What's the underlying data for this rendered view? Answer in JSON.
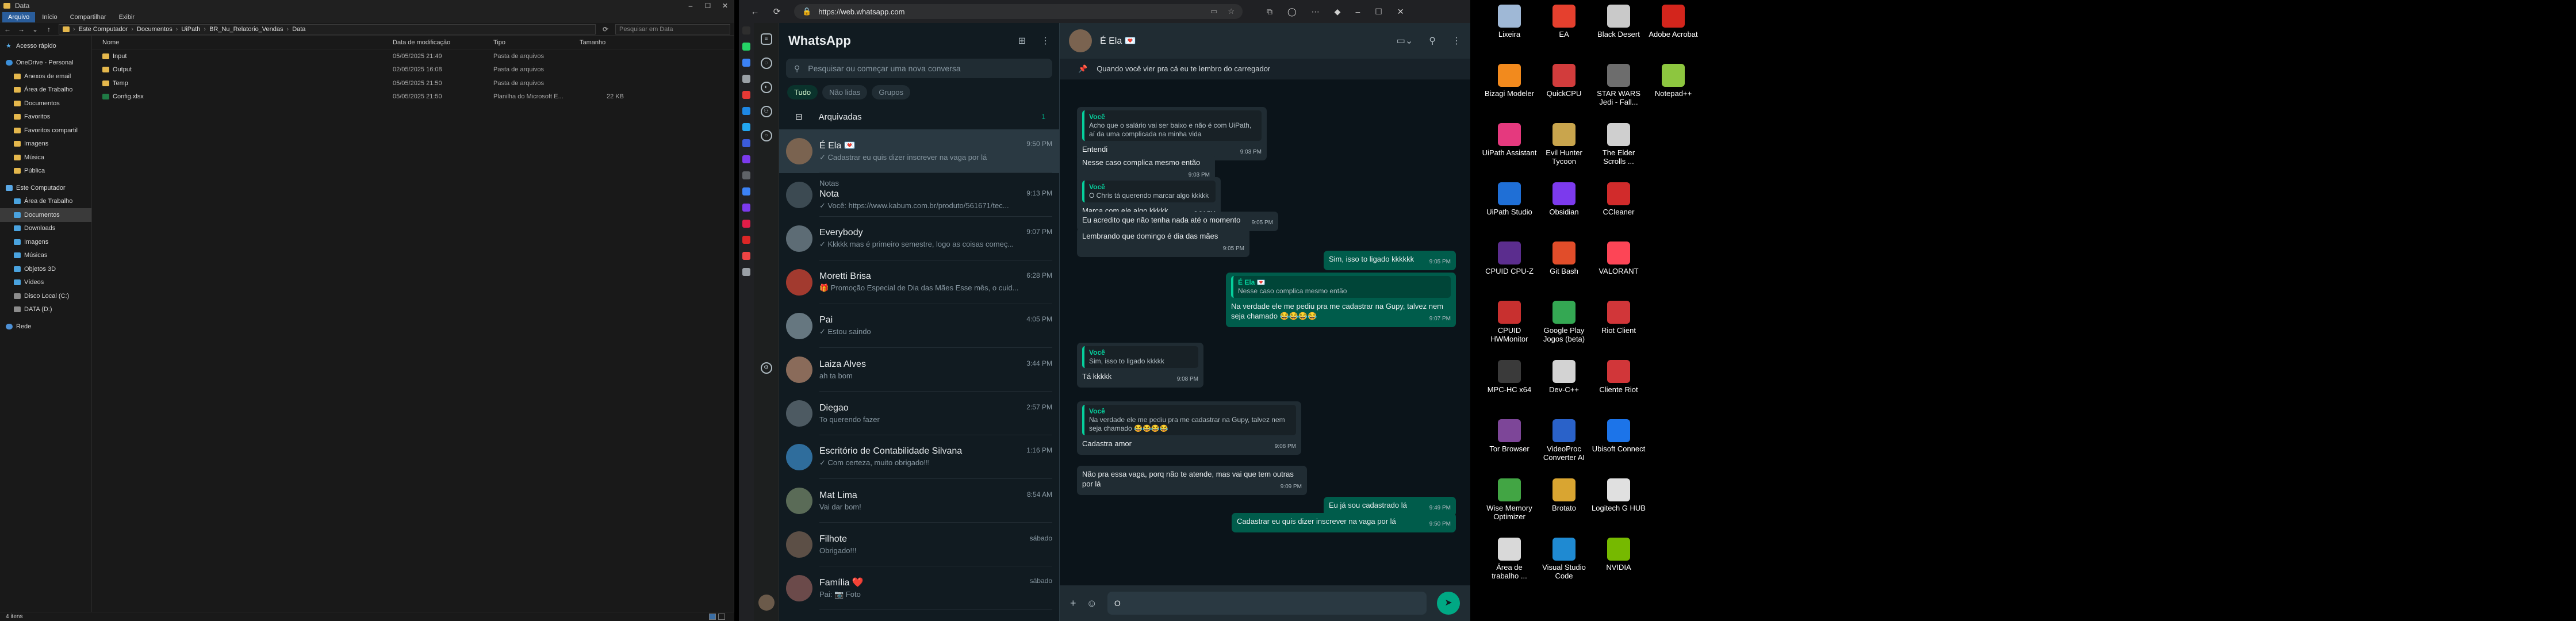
{
  "explorer": {
    "window_title": "Data",
    "ribbon_tabs": [
      "Arquivo",
      "Início",
      "Compartilhar",
      "Exibir"
    ],
    "breadcrumb": [
      "Este Computador",
      "Documentos",
      "UiPath",
      "BR_Nu_Relatorio_Vendas",
      "Data"
    ],
    "search_placeholder": "Pesquisar em Data",
    "nav": [
      {
        "label": "Acesso rápido",
        "icon": "star-icon",
        "level": 0
      },
      {
        "label": "OneDrive - Personal",
        "icon": "cloud-icon",
        "level": 0
      },
      {
        "label": "Anexos de email",
        "icon": "folder-icon",
        "level": 1
      },
      {
        "label": "Área de Trabalho",
        "icon": "folder-icon",
        "level": 1
      },
      {
        "label": "Documentos",
        "icon": "folder-icon",
        "level": 1
      },
      {
        "label": "Favoritos",
        "icon": "folder-icon",
        "level": 1
      },
      {
        "label": "Favoritos compartil",
        "icon": "folder-icon",
        "level": 1
      },
      {
        "label": "Imagens",
        "icon": "folder-icon",
        "level": 1
      },
      {
        "label": "Música",
        "icon": "folder-icon",
        "level": 1
      },
      {
        "label": "Pública",
        "icon": "folder-icon",
        "level": 1
      },
      {
        "label": "Este Computador",
        "icon": "computer-icon",
        "level": 0
      },
      {
        "label": "Área de Trabalho",
        "icon": "desktop-icon",
        "level": 1
      },
      {
        "label": "Documentos",
        "icon": "documents-icon",
        "level": 1,
        "selected": true
      },
      {
        "label": "Downloads",
        "icon": "downloads-icon",
        "level": 1
      },
      {
        "label": "Imagens",
        "icon": "pictures-icon",
        "level": 1
      },
      {
        "label": "Músicas",
        "icon": "music-icon",
        "level": 1
      },
      {
        "label": "Objetos 3D",
        "icon": "objects3d-icon",
        "level": 1
      },
      {
        "label": "Vídeos",
        "icon": "videos-icon",
        "level": 1
      },
      {
        "label": "Disco Local (C:)",
        "icon": "drive-icon",
        "level": 1
      },
      {
        "label": "DATA (D:)",
        "icon": "drive-icon",
        "level": 1
      },
      {
        "label": "Rede",
        "icon": "network-icon",
        "level": 0
      }
    ],
    "columns": [
      "Nome",
      "Data de modificação",
      "Tipo",
      "Tamanho"
    ],
    "files": [
      {
        "name": "Input",
        "modified": "05/05/2025 21:49",
        "type": "Pasta de arquivos",
        "size": "",
        "icon": "folder-icon"
      },
      {
        "name": "Output",
        "modified": "02/05/2025 16:08",
        "type": "Pasta de arquivos",
        "size": "",
        "icon": "folder-icon"
      },
      {
        "name": "Temp",
        "modified": "05/05/2025 21:50",
        "type": "Pasta de arquivos",
        "size": "",
        "icon": "folder-icon"
      },
      {
        "name": "Config.xlsx",
        "modified": "05/05/2025 21:50",
        "type": "Planilha do Microsoft E...",
        "size": "22 KB",
        "icon": "excel-icon"
      }
    ],
    "status": "4 itens"
  },
  "browser": {
    "url": "https://web.whatsapp.com"
  },
  "whatsapp": {
    "title": "WhatsApp",
    "search_placeholder": "Pesquisar ou começar uma nova conversa",
    "filters": [
      "Tudo",
      "Não lidas",
      "Grupos"
    ],
    "active_filter": "Tudo",
    "archived_label": "Arquivadas",
    "archived_count": "1",
    "chats": [
      {
        "name": "É Ela 💌",
        "time": "9:50 PM",
        "preview": "✓ Cadastrar eu quis dizer inscrever na vaga por lá",
        "selected": true
      },
      {
        "name": "Nota",
        "time": "9:13 PM",
        "preview": "✓ Você: https://www.kabum.com.br/produto/561671/tec...",
        "sub": "Notas"
      },
      {
        "name": "Everybody",
        "time": "9:07 PM",
        "preview": "✓ Kkkkk mas é primeiro semestre, logo as coisas começ..."
      },
      {
        "name": "Moretti Brisa",
        "time": "6:28 PM",
        "preview": "🎁 Promoção Especial de Dia das Mães Esse mês, o cuid..."
      },
      {
        "name": "Pai",
        "time": "4:05 PM",
        "preview": "✓ Estou saindo"
      },
      {
        "name": "Laiza Alves",
        "time": "3:44 PM",
        "preview": "ah ta bom"
      },
      {
        "name": "Diegao",
        "time": "2:57 PM",
        "preview": "To querendo fazer"
      },
      {
        "name": "Escritório de Contabilidade Silvana",
        "time": "1:16 PM",
        "preview": "✓ Com certeza, muito obrigado!!!"
      },
      {
        "name": "Mat Lima",
        "time": "8:54 AM",
        "preview": "Vai dar bom!"
      },
      {
        "name": "Filhote",
        "time": "sábado",
        "preview": "Obrigado!!!"
      },
      {
        "name": "Família ❤️",
        "time": "sábado",
        "preview": "Pai: 📷 Foto"
      }
    ],
    "conversation": {
      "contact": "É Ela 💌",
      "pinned": "Quando você vier pra cá eu te lembro do carregador",
      "messages": [
        {
          "dir": "in",
          "quote_name": "Você",
          "quote": "Acho que o salário vai ser baixo e não é com UiPath, aí da uma complicada na minha vida",
          "text": "Entendi",
          "time": "9:03 PM"
        },
        {
          "dir": "in",
          "text": "Nesse caso complica mesmo então",
          "time": "9:03 PM"
        },
        {
          "dir": "in",
          "quote_name": "Você",
          "quote": "O Chris tá querendo marcar algo kkkkk",
          "text": "Marca com ele algo kkkkk",
          "time": "9:04 PM"
        },
        {
          "dir": "in",
          "text": "Eu acredito que não tenha nada até o momento",
          "time": "9:05 PM"
        },
        {
          "dir": "in",
          "text": "Lembrando que domingo é dia das mães",
          "time": "9:05 PM"
        },
        {
          "dir": "out",
          "text": "Sim, isso to ligado kkkkkk",
          "time": "9:05 PM"
        },
        {
          "dir": "out",
          "quote_name": "É Ela 💌",
          "quote": "Nesse caso complica mesmo então",
          "text": "Na verdade ele me pediu pra me cadastrar na Gupy, talvez nem seja chamado 😂😂😂😂",
          "time": "9:07 PM"
        },
        {
          "dir": "in",
          "quote_name": "Você",
          "quote": "Sim, isso to ligado kkkkk",
          "text": "Tá kkkkk",
          "time": "9:08 PM"
        },
        {
          "dir": "in",
          "quote_name": "Você",
          "quote": "Na verdade ele me pediu pra me cadastrar na Gupy, talvez nem seja chamado 😂😂😂😂",
          "text": "Cadastra amor",
          "time": "9:08 PM"
        },
        {
          "dir": "in",
          "text": "Não pra essa vaga, porq não te atende, mas vai que tem outras por lá",
          "time": "9:09 PM"
        },
        {
          "dir": "out",
          "text": "Eu já sou cadastrado lá",
          "time": "9:49 PM"
        },
        {
          "dir": "out",
          "text": "Cadastrar eu quis dizer inscrever na vaga por lá",
          "time": "9:50 PM"
        }
      ],
      "composer_value": "O"
    }
  },
  "desktop": {
    "icons": [
      {
        "label": "Lixeira",
        "color": "#9fb8d6"
      },
      {
        "label": "EA",
        "color": "#e5402e"
      },
      {
        "label": "Black Desert",
        "color": "#c9c9c9"
      },
      {
        "label": "Adobe Acrobat",
        "color": "#d3251c"
      },
      {
        "label": "Bizagi Modeler",
        "color": "#f28a1d"
      },
      {
        "label": "QuickCPU",
        "color": "#d23c3c"
      },
      {
        "label": "STAR WARS Jedi - Fall...",
        "color": "#6d6d6d"
      },
      {
        "label": "Notepad++",
        "color": "#8dc63f"
      },
      {
        "label": "UiPath Assistant",
        "color": "#e5397e"
      },
      {
        "label": "Evil Hunter Tycoon",
        "color": "#c9a54d"
      },
      {
        "label": "The Elder Scrolls ...",
        "color": "#cfcfcf"
      },
      {
        "label": "",
        "color": ""
      },
      {
        "label": "UiPath Studio",
        "color": "#1f6fd6"
      },
      {
        "label": "Obsidian",
        "color": "#7c3aed"
      },
      {
        "label": "CCleaner",
        "color": "#d12b2b"
      },
      {
        "label": "",
        "color": ""
      },
      {
        "label": "CPUID CPU-Z",
        "color": "#5b2d8e"
      },
      {
        "label": "Git Bash",
        "color": "#e14d2a"
      },
      {
        "label": "VALORANT",
        "color": "#fd4556"
      },
      {
        "label": "",
        "color": ""
      },
      {
        "label": "CPUID HWMonitor",
        "color": "#c8302f"
      },
      {
        "label": "Google Play Jogos (beta)",
        "color": "#34a853"
      },
      {
        "label": "Riot Client",
        "color": "#d13639"
      },
      {
        "label": "",
        "color": ""
      },
      {
        "label": "MPC-HC x64",
        "color": "#3a3a3a"
      },
      {
        "label": "Dev-C++",
        "color": "#d3d3d3"
      },
      {
        "label": "Cliente Riot",
        "color": "#d13639"
      },
      {
        "label": "",
        "color": ""
      },
      {
        "label": "Tor Browser",
        "color": "#7d4698"
      },
      {
        "label": "VideoProc Converter AI",
        "color": "#2a62c9"
      },
      {
        "label": "Ubisoft Connect",
        "color": "#1c74e9"
      },
      {
        "label": "",
        "color": ""
      },
      {
        "label": "Wise Memory Optimizer",
        "color": "#42a544"
      },
      {
        "label": "Brotato",
        "color": "#d9a531"
      },
      {
        "label": "Logitech G HUB",
        "color": "#e0e0e0"
      },
      {
        "label": "",
        "color": ""
      },
      {
        "label": "Área de trabalho ...",
        "color": "#d9d9d9"
      },
      {
        "label": "Visual Studio Code",
        "color": "#1f8ad2"
      },
      {
        "label": "NVIDIA",
        "color": "#76b900"
      },
      {
        "label": "",
        "color": ""
      }
    ]
  }
}
